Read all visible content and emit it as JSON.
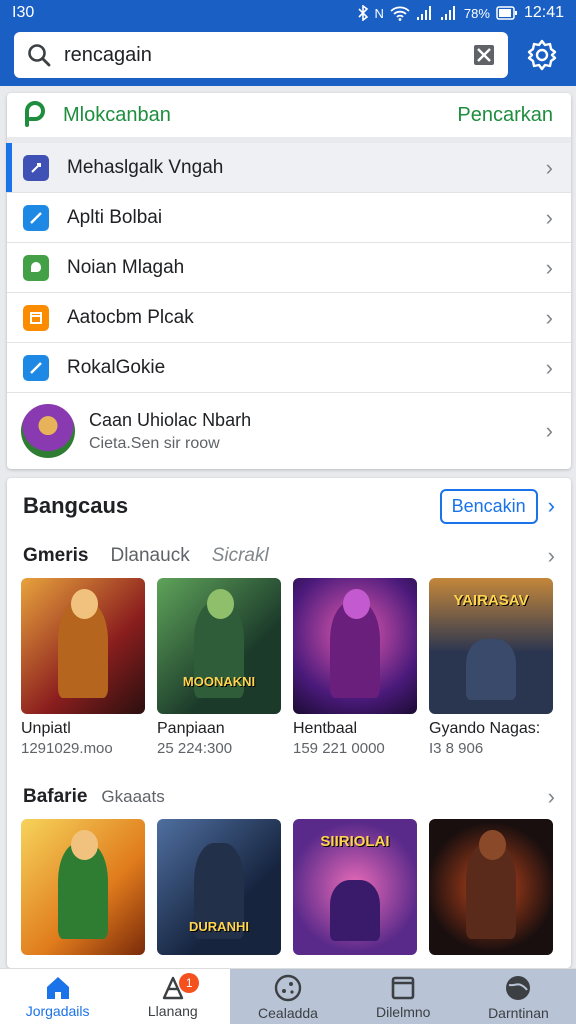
{
  "status_bar": {
    "left": "I30",
    "signal_text": "N",
    "battery": "78%",
    "time": "12:41"
  },
  "search": {
    "value": "rencagain"
  },
  "suggestions": {
    "header_title": "Mlokcanban",
    "header_action": "Pencarkan",
    "items": [
      {
        "label": "Mehaslgalk Vngah",
        "color": "#3f51b5"
      },
      {
        "label": "Aplti Bolbai",
        "color": "#1e88e5"
      },
      {
        "label": "Noian Mlagah",
        "color": "#43a047"
      },
      {
        "label": "Aatocbm Plcak",
        "color": "#fb8c00"
      },
      {
        "label": "RokalGokie",
        "color": "#1e88e5"
      }
    ],
    "app": {
      "title": "Caan Uhiolac Nbarh",
      "subtitle": "Cieta.Sen sir roow"
    }
  },
  "section": {
    "title": "Bangcaus",
    "button": "Bencakin",
    "tabs": [
      "Gmeris",
      "Dlanauck",
      "Sicrakl"
    ],
    "games": [
      {
        "name": "Unpiatl",
        "meta": "1291029.moo",
        "art_title": "",
        "c1": "#8b1e1e",
        "c2": "#e8a33d"
      },
      {
        "name": "Panpiaan",
        "meta": "25 224:300",
        "art_title": "MOONAKNI",
        "c1": "#1b3a2a",
        "c2": "#5fa35a"
      },
      {
        "name": "Hentbaal",
        "meta": "159 221 0000",
        "art_title": "",
        "c1": "#4a1a7a",
        "c2": "#e25ab0"
      },
      {
        "name": "Gyando Nagas:",
        "meta": "I3 8 906",
        "art_title": "YAIRASAV",
        "c1": "#2a3550",
        "c2": "#c4873a"
      }
    ],
    "tabs2": [
      "Bafarie",
      "Gkaaats"
    ],
    "games2": [
      {
        "art_title": "",
        "c1": "#e07b1c",
        "c2": "#f6d35b"
      },
      {
        "art_title": "DURANHI",
        "c1": "#16243e",
        "c2": "#4f6fa0"
      },
      {
        "art_title": "SIIRIOLAI",
        "c1": "#5a2a8a",
        "c2": "#e96bb8"
      },
      {
        "art_title": "",
        "c1": "#1a0f0f",
        "c2": "#c0461b"
      }
    ]
  },
  "bottom_nav": [
    {
      "label": "Jorgadails",
      "icon": "home-icon",
      "badge": ""
    },
    {
      "label": "Llanang",
      "icon": "cone-icon",
      "badge": "1"
    },
    {
      "label": "Cealadda",
      "icon": "compass-icon",
      "badge": ""
    },
    {
      "label": "Dilelmno",
      "icon": "square-icon",
      "badge": ""
    },
    {
      "label": "Darntinan",
      "icon": "globe-icon",
      "badge": ""
    }
  ]
}
